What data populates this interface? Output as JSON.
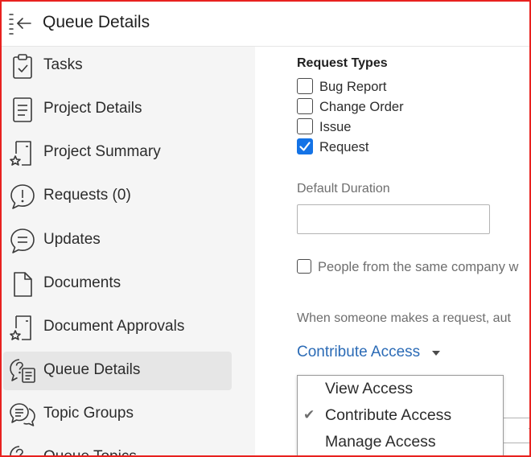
{
  "header": {
    "title": "Queue Details"
  },
  "sidebar": {
    "items": [
      {
        "label": "Tasks",
        "icon": "tasks-clipboard-icon"
      },
      {
        "label": "Project Details",
        "icon": "document-lines-icon"
      },
      {
        "label": "Project Summary",
        "icon": "summary-star-icon"
      },
      {
        "label": "Requests (0)",
        "icon": "alert-speech-bubble-icon"
      },
      {
        "label": "Updates",
        "icon": "updates-speech-bubble-icon"
      },
      {
        "label": "Documents",
        "icon": "document-icon"
      },
      {
        "label": "Document Approvals",
        "icon": "document-approval-star-icon"
      },
      {
        "label": "Queue Details",
        "icon": "queue-details-icon",
        "active": true
      },
      {
        "label": "Topic Groups",
        "icon": "topic-groups-icon"
      },
      {
        "label": "Queue Topics",
        "icon": "queue-topics-icon"
      }
    ]
  },
  "main": {
    "request_types": {
      "title": "Request Types",
      "options": [
        {
          "label": "Bug Report",
          "checked": false
        },
        {
          "label": "Change Order",
          "checked": false
        },
        {
          "label": "Issue",
          "checked": false
        },
        {
          "label": "Request",
          "checked": true
        }
      ]
    },
    "default_duration": {
      "label": "Default Duration",
      "value": ""
    },
    "same_company": {
      "label": "People from the same company w",
      "checked": false
    },
    "auto_access_hint": "When someone makes a request, aut",
    "access_picker": {
      "label": "Contribute Access"
    },
    "access_menu": {
      "options": [
        {
          "label": "View Access",
          "selected": false
        },
        {
          "label": "Contribute Access",
          "selected": true
        },
        {
          "label": "Manage Access",
          "selected": false
        }
      ],
      "check_glyph": "✔"
    }
  },
  "colors": {
    "frame_border": "#e8211f",
    "sidebar_bg": "#f5f5f5",
    "active_item_bg": "#e6e6e6",
    "link_blue": "#2b6bb6",
    "checkbox_blue": "#1473e6"
  }
}
